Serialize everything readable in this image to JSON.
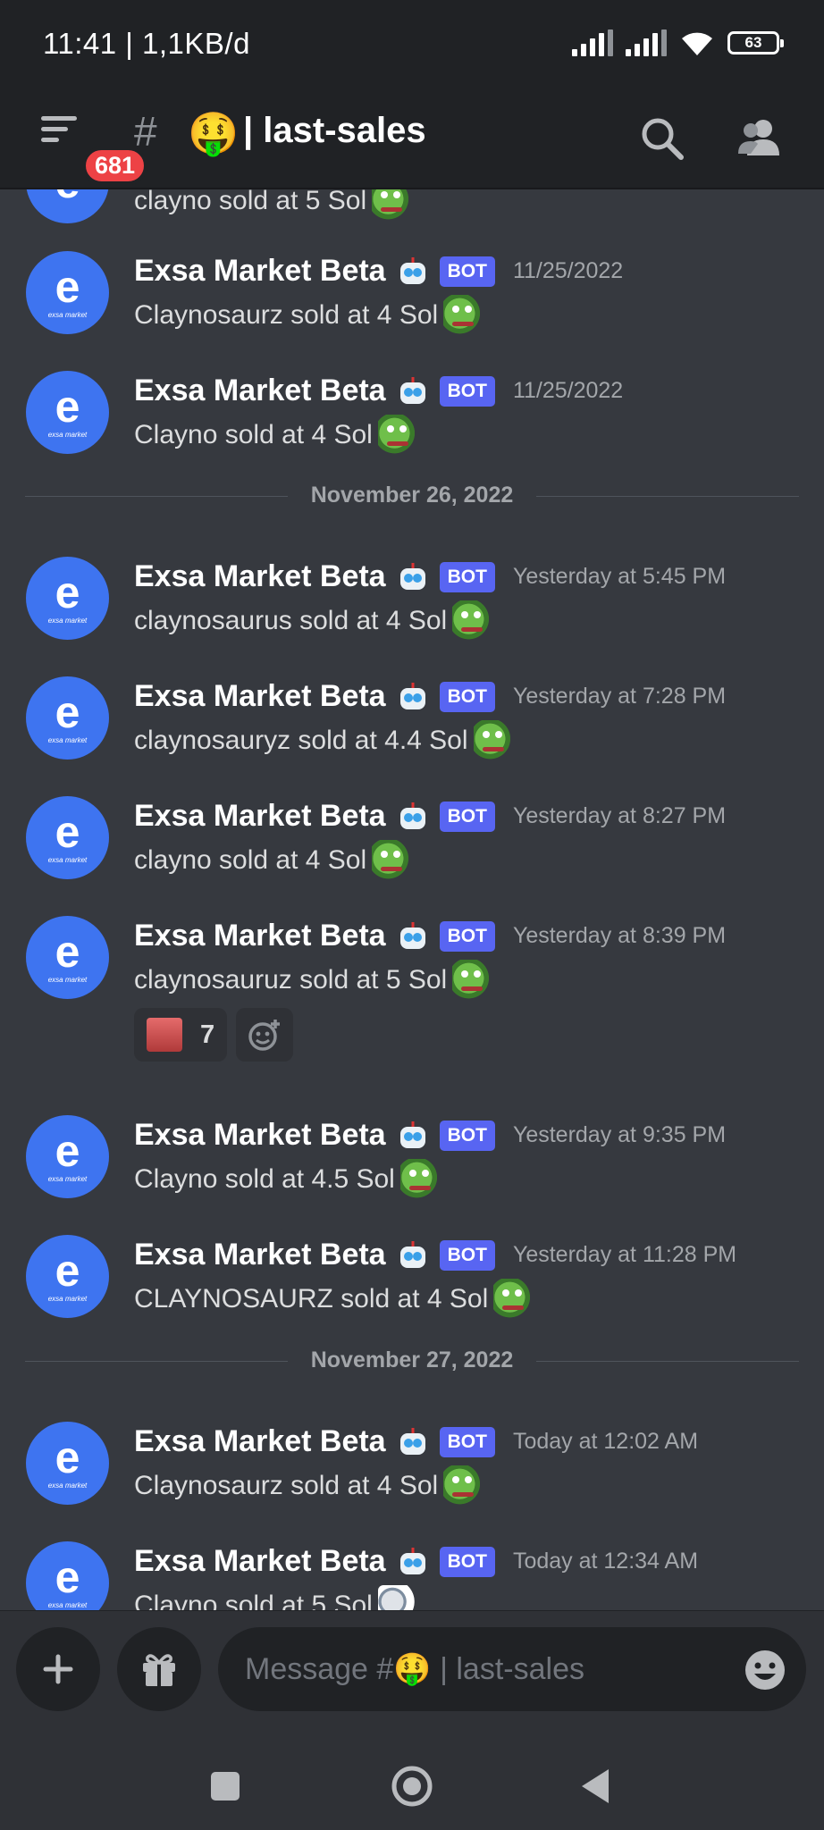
{
  "status_bar": {
    "time": "11:41 | 1,1KB/d",
    "battery": "63"
  },
  "header": {
    "mention_count": "681",
    "hash": "#",
    "channel_emoji": "🤑",
    "channel_name": "| last-sales"
  },
  "partial_top_message": {
    "content": "clayno sold at 5 Sol"
  },
  "messages": [
    {
      "author": "Exsa Market Beta",
      "tag": "BOT",
      "time": "11/25/2022",
      "content": "Claynosaurz sold at 4 Sol",
      "emoji": "frog"
    },
    {
      "author": "Exsa Market Beta",
      "tag": "BOT",
      "time": "11/25/2022",
      "content": "Clayno sold at 4 Sol",
      "emoji": "frog"
    },
    {
      "author": "Exsa Market Beta",
      "tag": "BOT",
      "time": "Yesterday at 5:45 PM",
      "content": "claynosaurus sold at 4 Sol",
      "emoji": "frog"
    },
    {
      "author": "Exsa Market Beta",
      "tag": "BOT",
      "time": "Yesterday at 7:28 PM",
      "content": "claynosauryz sold at 4.4 Sol",
      "emoji": "frog"
    },
    {
      "author": "Exsa Market Beta",
      "tag": "BOT",
      "time": "Yesterday at 8:27 PM",
      "content": "clayno sold at 4 Sol",
      "emoji": "frog"
    },
    {
      "author": "Exsa Market Beta",
      "tag": "BOT",
      "time": "Yesterday at 8:39 PM",
      "content": "claynosauruz sold at 5 Sol",
      "emoji": "frog"
    },
    {
      "author": "Exsa Market Beta",
      "tag": "BOT",
      "time": "Yesterday at 9:35 PM",
      "content": "Clayno sold at 4.5 Sol",
      "emoji": "frog"
    },
    {
      "author": "Exsa Market Beta",
      "tag": "BOT",
      "time": "Yesterday at 11:28 PM",
      "content": "CLAYNOSAURZ sold at 4 Sol",
      "emoji": "frog"
    },
    {
      "author": "Exsa Market Beta",
      "tag": "BOT",
      "time": "Today at 12:02 AM",
      "content": "Claynosaurz sold at 4 Sol",
      "emoji": "frog"
    },
    {
      "author": "Exsa Market Beta",
      "tag": "BOT",
      "time": "Today at 12:34 AM",
      "content": "Clayno sold at 5 Sol",
      "emoji": "magnifier"
    }
  ],
  "dividers": [
    "November 26, 2022",
    "November 27, 2022"
  ],
  "reaction": {
    "count": "7"
  },
  "avatar_text": {
    "letter": "e",
    "caption": "exsa market"
  },
  "composer": {
    "placeholder": "Message #🤑 | last-sales"
  },
  "colors": {
    "background": "#36393f",
    "header": "#202225",
    "bot_tag": "#5865f2",
    "badge": "#ed4245",
    "avatar": "#3e74f0"
  }
}
